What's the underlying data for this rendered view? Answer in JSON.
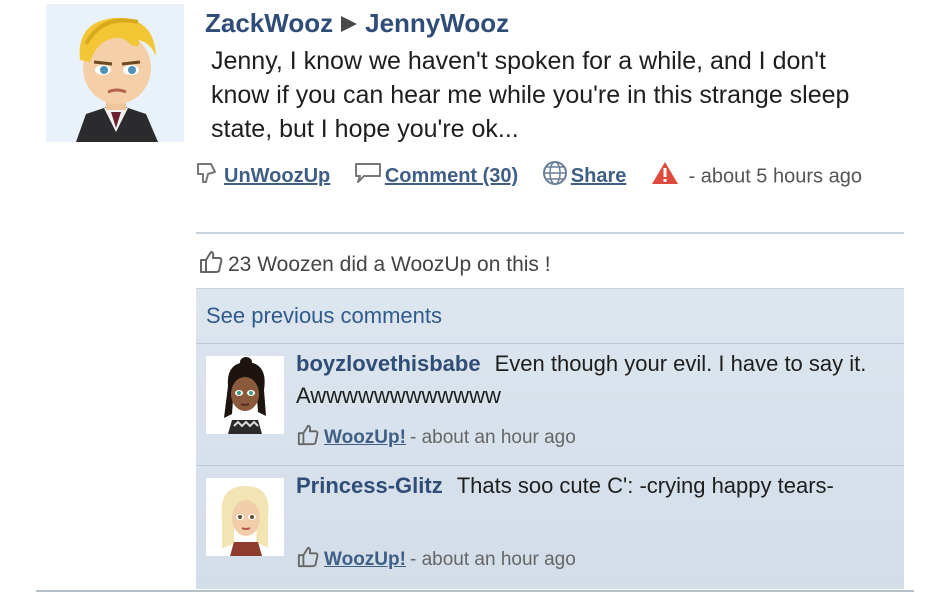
{
  "post": {
    "author": "ZackWooz",
    "recipient": "JennyWooz",
    "text": "Jenny, I know we haven't spoken for a while, and I don't know if you can hear me while you're in this strange sleep state, but I hope you're ok...",
    "actions": {
      "unwoozup": "UnWoozUp",
      "comment": "Comment (30)",
      "share": "Share",
      "time": "- about 5 hours ago"
    },
    "woozup_count_text": "23 Woozen did a WoozUp on this !"
  },
  "comments": {
    "see_previous": "See previous comments",
    "items": [
      {
        "user": "boyzlovethisbabe",
        "text": "Even though your evil. I have to say it. Awwwwwwwwwwww",
        "woozup_label": "WoozUp!",
        "time": "- about an hour ago"
      },
      {
        "user": "Princess-Glitz",
        "text": "Thats soo cute C': -crying happy tears-",
        "woozup_label": "WoozUp!",
        "time": "- about an hour ago"
      }
    ]
  },
  "icons": {
    "thumbs_down": "thumbs-down-icon",
    "comment": "speech-bubble-icon",
    "share": "globe-icon",
    "report": "warning-icon",
    "thumbs_up": "thumbs-up-icon"
  },
  "colors": {
    "link": "#3f5f86",
    "username": "#2f4d77",
    "comment_bg": "#d8e2ec",
    "report": "#e04a3c"
  }
}
